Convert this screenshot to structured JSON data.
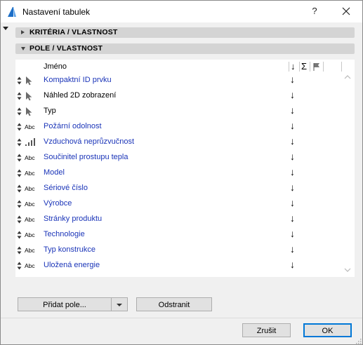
{
  "window": {
    "title": "Nastavení tabulek",
    "help_label": "?"
  },
  "sections": {
    "criteria_label": "KRITÉRIA / VLASTNOST",
    "fields_label": "POLE / VLASTNOST"
  },
  "list": {
    "header": {
      "name": "Jméno",
      "sort_glyph": "↓",
      "sum_glyph": "Σ"
    },
    "rows": [
      {
        "type_icon": "cursor-icon",
        "type_text": "",
        "name": "Kompaktní ID prvku",
        "sort": "↓",
        "link": true
      },
      {
        "type_icon": "cursor-icon",
        "type_text": "",
        "name": "Náhled 2D zobrazení",
        "sort": "↓",
        "link": false
      },
      {
        "type_icon": "cursor-icon",
        "type_text": "",
        "name": "Typ",
        "sort": "↓",
        "link": false
      },
      {
        "type_icon": "abc-icon",
        "type_text": "Abc",
        "name": "Požární odolnost",
        "sort": "↓",
        "link": true
      },
      {
        "type_icon": "scale-icon",
        "type_text": "",
        "name": "Vzduchová neprůzvučnost",
        "sort": "↓",
        "link": true
      },
      {
        "type_icon": "abc-icon",
        "type_text": "Abc",
        "name": "Součinitel prostupu tepla",
        "sort": "↓",
        "link": true
      },
      {
        "type_icon": "abc-icon",
        "type_text": "Abc",
        "name": "Model",
        "sort": "↓",
        "link": true
      },
      {
        "type_icon": "abc-icon",
        "type_text": "Abc",
        "name": "Sériové číslo",
        "sort": "↓",
        "link": true
      },
      {
        "type_icon": "abc-icon",
        "type_text": "Abc",
        "name": "Výrobce",
        "sort": "↓",
        "link": true
      },
      {
        "type_icon": "abc-icon",
        "type_text": "Abc",
        "name": "Stránky produktu",
        "sort": "↓",
        "link": true
      },
      {
        "type_icon": "abc-icon",
        "type_text": "Abc",
        "name": "Technologie",
        "sort": "↓",
        "link": true
      },
      {
        "type_icon": "abc-icon",
        "type_text": "Abc",
        "name": "Typ konstrukce",
        "sort": "↓",
        "link": true
      },
      {
        "type_icon": "abc-icon",
        "type_text": "Abc",
        "name": "Uložená energie",
        "sort": "↓",
        "link": true
      }
    ]
  },
  "buttons": {
    "add_field": "Přidat pole...",
    "remove": "Odstranit",
    "cancel": "Zrušit",
    "ok": "OK"
  },
  "colors": {
    "link": "#1a34b8",
    "section_bg": "#d4d4d4",
    "primary_border": "#0078d7"
  }
}
